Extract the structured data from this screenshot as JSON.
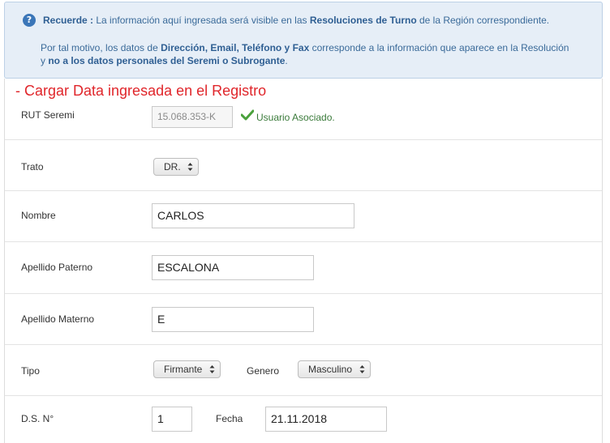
{
  "notice": {
    "icon": "question-circle-icon",
    "line1_lead": "Recuerde :",
    "line1_text": " La información aquí ingresada será visible en las ",
    "line1_bold": "Resoluciones de Turno",
    "line1_tail": " de la Región correspondiente.",
    "line2_text": "Por tal motivo, los datos de ",
    "line2_bold": "Dirección, Email, Teléfono y Fax",
    "line2_tail": " corresponde a la información que aparece en la Resolución",
    "line3_lead": "y ",
    "line3_bold": "no a los datos personales del Seremi o Subrogante",
    "line3_tail": "."
  },
  "section_title": "- Cargar Data ingresada en el Registro",
  "form": {
    "rut_label": "RUT Seremi",
    "rut_value": "15.068.353-K",
    "rut_status": "Usuario Asociado.",
    "trato_label": "Trato",
    "trato_value": "DR.",
    "nombre_label": "Nombre",
    "nombre_value": "CARLOS",
    "paterno_label": "Apellido Paterno",
    "paterno_value": "ESCALONA",
    "materno_label": "Apellido Materno",
    "materno_value": "E",
    "tipo_label": "Tipo",
    "tipo_value": "Firmante",
    "genero_label": "Genero",
    "genero_value": "Masculino",
    "ds_label": "D.S. N°",
    "ds_value": "1",
    "fecha_label": "Fecha",
    "fecha_value": "21.11.2018"
  },
  "colors": {
    "title_red": "#e0262b",
    "notice_bg": "#e6eef7",
    "success_green": "#3a7a3a"
  }
}
